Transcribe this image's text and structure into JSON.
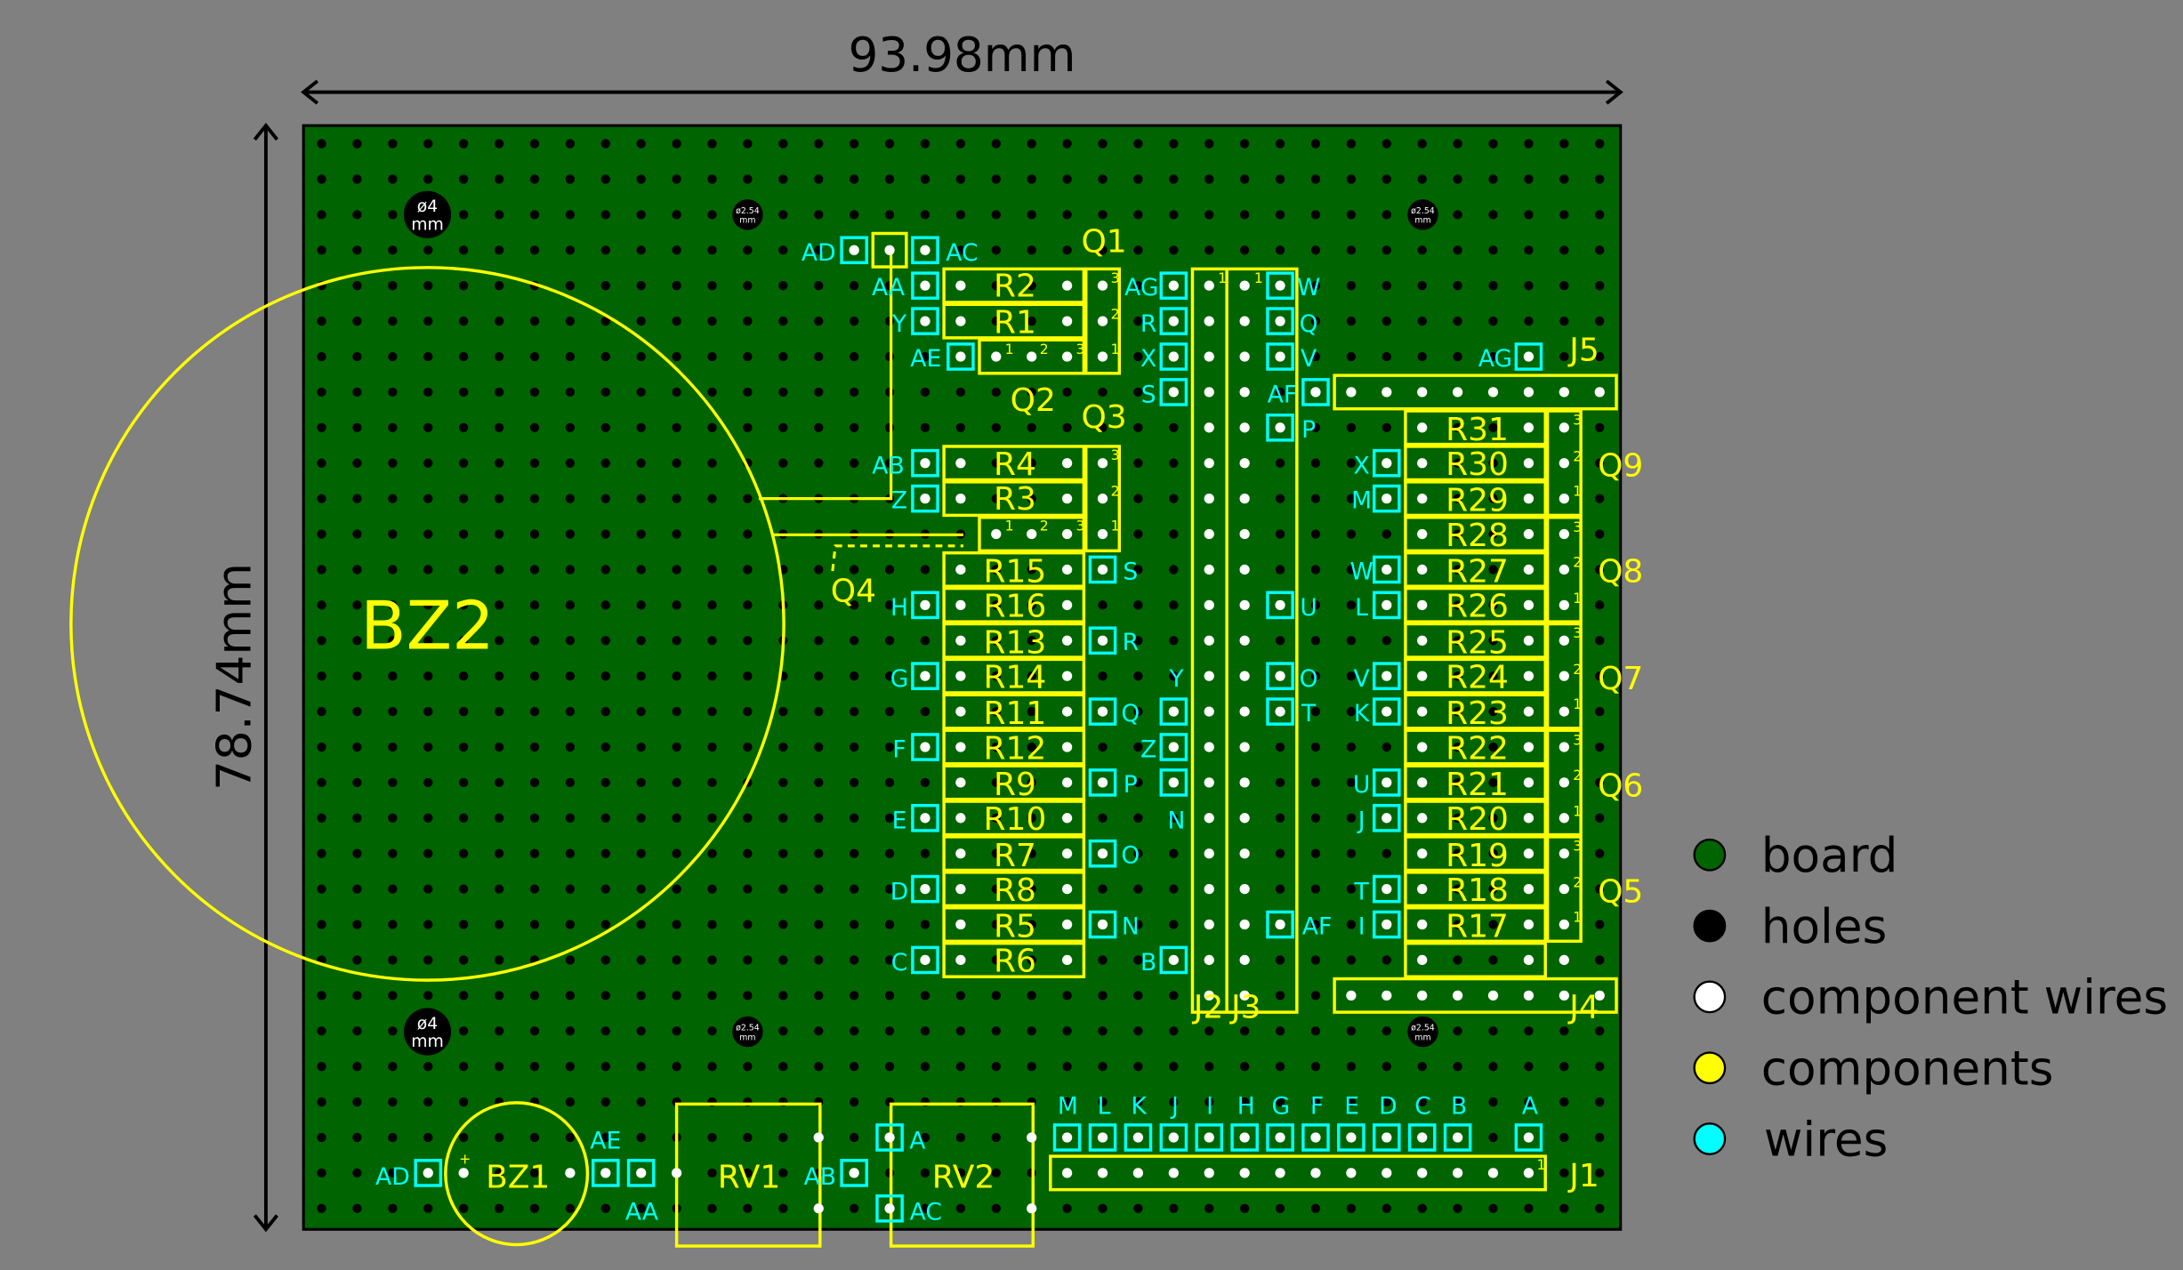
{
  "dimensions": {
    "width_label": "93.98mm",
    "height_label": "78.74mm"
  },
  "mounting_holes": {
    "large_label_top": "ø4",
    "large_label_bottom": "mm",
    "small_label_top": "ø2.54",
    "small_label_bottom": "mm"
  },
  "components": {
    "bz2": "BZ2",
    "bz1": "BZ1",
    "rv1": "RV1",
    "rv2": "RV2",
    "q1": "Q1",
    "q2": "Q2",
    "q3": "Q3",
    "q4": "Q4",
    "q5": "Q5",
    "q6": "Q6",
    "q7": "Q7",
    "q8": "Q8",
    "q9": "Q9",
    "j1": "J1",
    "j2": "J2",
    "j3": "J3",
    "j4": "J4",
    "j5": "J5",
    "r1": "R1",
    "r2": "R2",
    "r3": "R3",
    "r4": "R4",
    "r5": "R5",
    "r6": "R6",
    "r7": "R7",
    "r8": "R8",
    "r9": "R9",
    "r10": "R10",
    "r11": "R11",
    "r12": "R12",
    "r13": "R13",
    "r14": "R14",
    "r15": "R15",
    "r16": "R16",
    "r17": "R17",
    "r18": "R18",
    "r19": "R19",
    "r20": "R20",
    "r21": "R21",
    "r22": "R22",
    "r23": "R23",
    "r24": "R24",
    "r25": "R25",
    "r26": "R26",
    "r27": "R27",
    "r28": "R28",
    "r29": "R29",
    "r30": "R30",
    "r31": "R31"
  },
  "pin_numbers": {
    "p1": "1",
    "p2": "2",
    "p3": "3"
  },
  "bz1_plus": "+",
  "wire_labels": {
    "ad_top": "AD",
    "ac_top": "AC",
    "aa_q1": "AA",
    "y_q1": "Y",
    "ae_q2": "AE",
    "ab_q3": "AB",
    "z_q3": "Z",
    "h": "H",
    "g": "G",
    "f": "F",
    "e": "E",
    "d": "D",
    "c": "C",
    "s_r15": "S",
    "r_r13": "R",
    "q_r11": "Q",
    "p_r9": "P",
    "o_r7": "O",
    "n_r5": "N",
    "ag_j2": "AG",
    "r_j2": "R",
    "x_j2": "X",
    "s_j2": "S",
    "y_j2": "Y",
    "z_j2": "Z",
    "n_j2": "N",
    "b_j2": "B",
    "w_j3": "W",
    "q_j3": "Q",
    "v_j3": "V",
    "af_j3": "AF",
    "p_j3": "P",
    "u_j3": "U",
    "o_j3": "O",
    "t_j3": "T",
    "af_j4": "AF",
    "ag_j5": "AG",
    "x_right": "X",
    "m_right": "M",
    "w_right": "W",
    "l_right": "L",
    "v_right": "V",
    "k_right": "K",
    "u_right": "U",
    "j_right": "J",
    "t_right": "T",
    "i_right": "I",
    "ad_bot": "AD",
    "ae_bot": "AE",
    "aa_bot": "AA",
    "ab_bot": "AB",
    "a_bot": "A",
    "ac_bot": "AC",
    "j1_m": "M",
    "j1_l": "L",
    "j1_k": "K",
    "j1_j": "J",
    "j1_i": "I",
    "j1_h": "H",
    "j1_g": "G",
    "j1_f": "F",
    "j1_e": "E",
    "j1_d": "D",
    "j1_c": "C",
    "j1_b": "B",
    "j1_a": "A"
  },
  "legend": [
    {
      "label": "board",
      "color": "#006400"
    },
    {
      "label": "holes",
      "color": "#000000"
    },
    {
      "label": "component wires",
      "color": "#ffffff"
    },
    {
      "label": "components",
      "color": "#ffff00"
    },
    {
      "label": "wires",
      "color": "#00ffff"
    }
  ],
  "colors": {
    "board": "#006400",
    "component": "#ffff00",
    "wire": "#00ffff",
    "hole": "#000000",
    "lead": "#ffffff",
    "background": "#808080"
  }
}
